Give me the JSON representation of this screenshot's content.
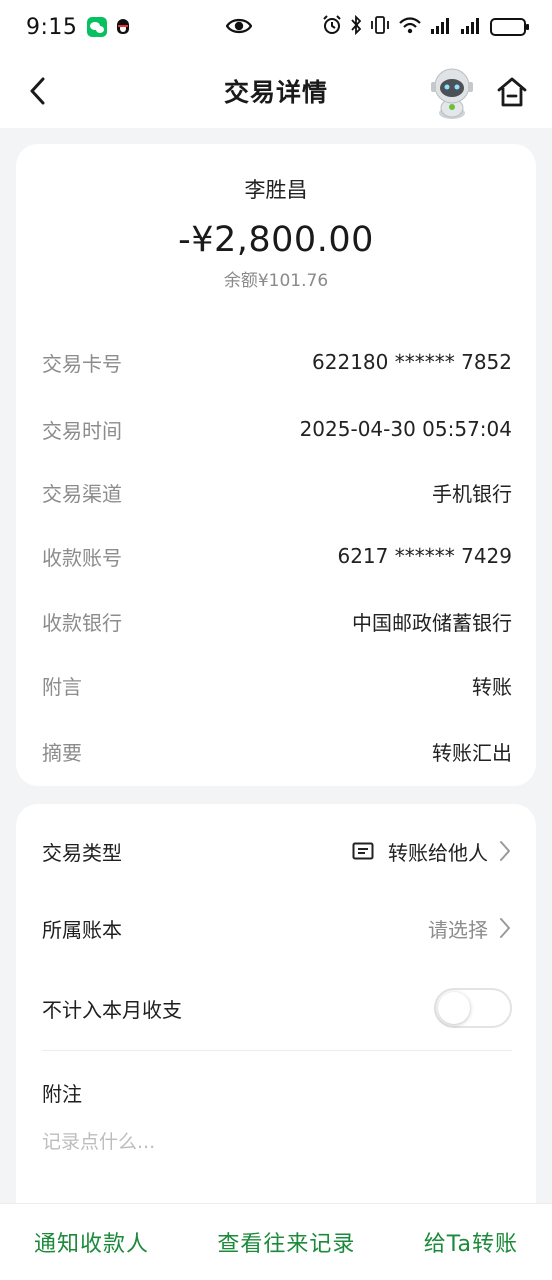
{
  "status_bar": {
    "time": "9:15",
    "icons": [
      "wechat-icon",
      "qq-icon",
      "eye-icon",
      "alarm-icon",
      "bluetooth-icon",
      "vibrate-icon",
      "wifi-icon",
      "signal-icon",
      "signal-icon",
      "battery-icon"
    ]
  },
  "header": {
    "title": "交易详情"
  },
  "transaction": {
    "payee": "李胜昌",
    "amount": "-¥2,800.00",
    "balance": "余额¥101.76"
  },
  "details": [
    {
      "label": "交易卡号",
      "value": "622180 ****** 7852"
    },
    {
      "label": "交易时间",
      "value": "2025-04-30 05:57:04"
    },
    {
      "label": "交易渠道",
      "value": "手机银行"
    },
    {
      "label": "收款账号",
      "value": "6217 ****** 7429"
    },
    {
      "label": "收款银行",
      "value": "中国邮政储蓄银行"
    },
    {
      "label": "附言",
      "value": "转账"
    },
    {
      "label": "摘要",
      "value": "转账汇出"
    }
  ],
  "settings": {
    "type_label": "交易类型",
    "type_value": "转账给他人",
    "ledger_label": "所属账本",
    "ledger_value": "请选择",
    "exclude_label": "不计入本月收支",
    "exclude_on": false,
    "note_label": "附注",
    "note_placeholder": "记录点什么..."
  },
  "bottom_actions": {
    "notify": "通知收款人",
    "history": "查看往来记录",
    "transfer": "给Ta转账"
  },
  "colors": {
    "accent": "#1b8a3a",
    "background": "#f3f4f6",
    "card": "#ffffff"
  }
}
